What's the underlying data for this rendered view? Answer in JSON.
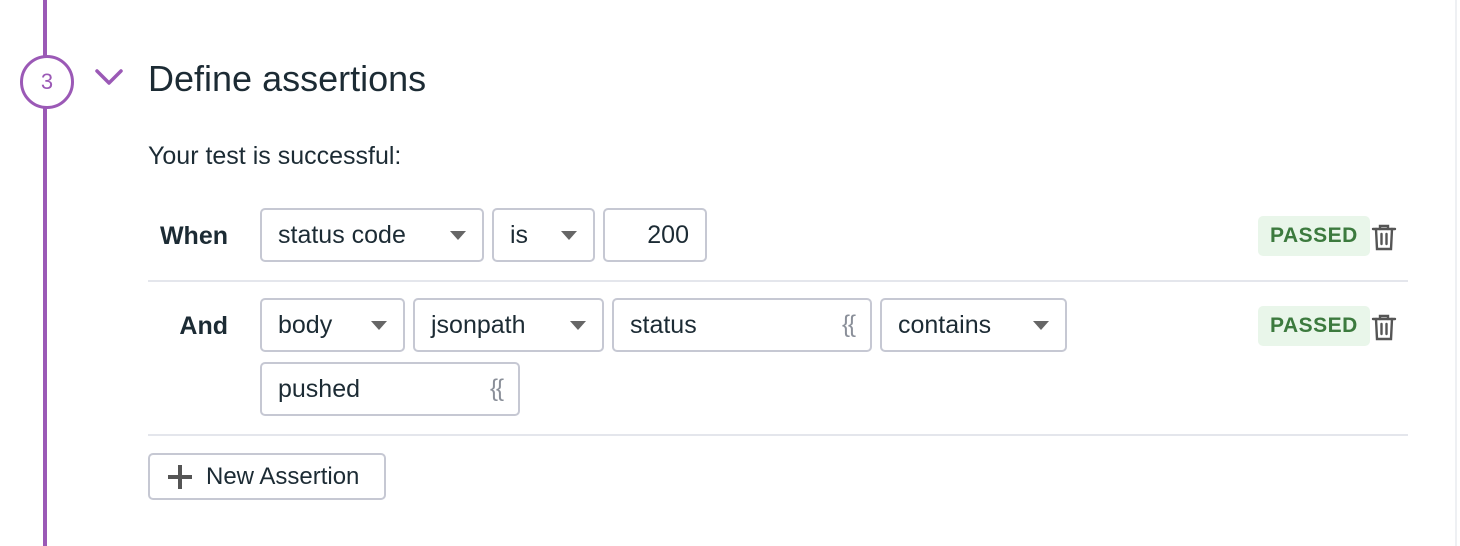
{
  "step": {
    "number": "3",
    "title": "Define assertions",
    "subtitle": "Your test is successful:"
  },
  "colors": {
    "accent": "#9b59b6",
    "passed_bg": "#e9f6ea",
    "passed_text": "#3c7a3e"
  },
  "assertions": [
    {
      "label": "When",
      "fields": [
        "status code",
        "is",
        "200"
      ],
      "status": "PASSED"
    },
    {
      "label": "And",
      "fields": [
        "body",
        "jsonpath",
        "status",
        "contains",
        "pushed"
      ],
      "status": "PASSED"
    }
  ],
  "icons": {
    "collapse": "chevron-down-icon",
    "delete": "trash-icon",
    "add": "plus-icon",
    "variable": "braces-icon"
  },
  "variable_glyph": "{{",
  "new_assertion_label": "New Assertion"
}
